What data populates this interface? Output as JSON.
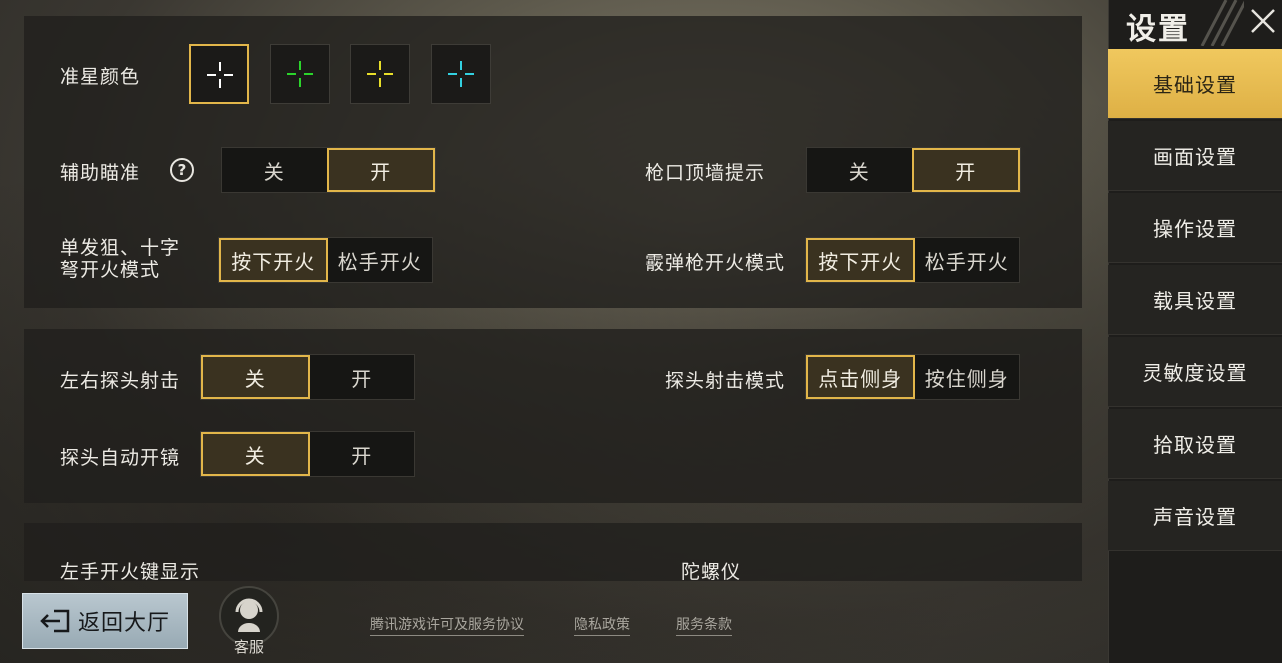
{
  "sidebar": {
    "title": "设置",
    "items": [
      {
        "label": "基础设置",
        "active": true
      },
      {
        "label": "画面设置"
      },
      {
        "label": "操作设置"
      },
      {
        "label": "载具设置"
      },
      {
        "label": "灵敏度设置"
      },
      {
        "label": "拾取设置"
      },
      {
        "label": "声音设置"
      }
    ]
  },
  "crosshair": {
    "label": "准星颜色",
    "colors": [
      "#ffffff",
      "#2bd42b",
      "#e8de2a",
      "#33d0e0"
    ],
    "selected_index": 0
  },
  "aim_assist": {
    "label": "辅助瞄准",
    "off": "关",
    "on": "开",
    "selected": "on"
  },
  "muzzle_wall": {
    "label": "枪口顶墙提示",
    "off": "关",
    "on": "开",
    "selected": "on"
  },
  "sniper_fire_mode": {
    "label": "单发狙、十字弩开火模式",
    "press": "按下开火",
    "release": "松手开火",
    "selected": "press"
  },
  "shotgun_fire_mode": {
    "label": "霰弹枪开火模式",
    "press": "按下开火",
    "release": "松手开火",
    "selected": "press"
  },
  "peek_fire": {
    "label": "左右探头射击",
    "off": "关",
    "on": "开",
    "selected": "off"
  },
  "peek_mode": {
    "label": "探头射击模式",
    "tap": "点击侧身",
    "hold": "按住侧身",
    "selected": "tap"
  },
  "peek_auto_scope": {
    "label": "探头自动开镜",
    "off": "关",
    "on": "开",
    "selected": "off"
  },
  "left_fire_button": {
    "label": "左手开火键显示"
  },
  "gyroscope": {
    "label": "陀螺仪"
  },
  "footer": {
    "back_label": "返回大厅",
    "cs_label": "客服",
    "links": [
      "腾讯游戏许可及服务协议",
      "隐私政策",
      "服务条款"
    ]
  },
  "colors": {
    "accent": "#e2b64a",
    "sidebar_active": "#e8bd52"
  }
}
